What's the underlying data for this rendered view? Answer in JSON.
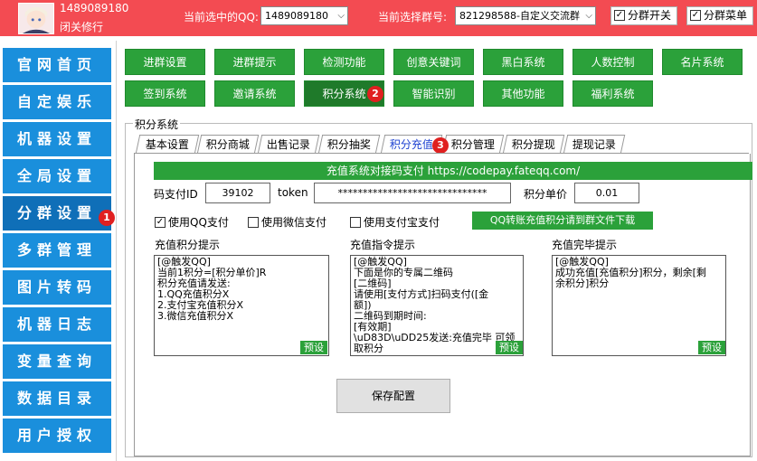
{
  "header": {
    "account_id": "1489089180",
    "account_name": "闭关修行",
    "qq_label": "当前选中的QQ:",
    "qq_value": "1489089180",
    "group_label": "当前选择群号:",
    "group_value": "821298588-自定义交流群",
    "toggle_group_switch": "分群开关",
    "toggle_group_menu": "分群菜单"
  },
  "sidebar": {
    "items": [
      {
        "label": "官网首页"
      },
      {
        "label": "自定娱乐"
      },
      {
        "label": "机器设置"
      },
      {
        "label": "全局设置"
      },
      {
        "label": "分群设置"
      },
      {
        "label": "多群管理"
      },
      {
        "label": "图片转码"
      },
      {
        "label": "机器日志"
      },
      {
        "label": "变量查询"
      },
      {
        "label": "数据目录"
      },
      {
        "label": "用户授权"
      }
    ],
    "badge": "1"
  },
  "function_buttons": [
    {
      "label": "进群设置"
    },
    {
      "label": "进群提示"
    },
    {
      "label": "检测功能"
    },
    {
      "label": "创意关键词"
    },
    {
      "label": "黑白系统"
    },
    {
      "label": "人数控制"
    },
    {
      "label": "名片系统"
    },
    {
      "label": "签到系统"
    },
    {
      "label": "邀请系统"
    },
    {
      "label": "积分系统"
    },
    {
      "label": "智能识别"
    },
    {
      "label": "其他功能"
    },
    {
      "label": "福利系统"
    }
  ],
  "function_badge": "2",
  "group_title": "积分系统",
  "tabs": [
    {
      "label": "基本设置"
    },
    {
      "label": "积分商城"
    },
    {
      "label": "出售记录"
    },
    {
      "label": "积分抽奖"
    },
    {
      "label": "积分充值"
    },
    {
      "label": "积分管理"
    },
    {
      "label": "积分提现"
    },
    {
      "label": "提现记录"
    }
  ],
  "tab_badge": "3",
  "recharge": {
    "banner": "充值系统对接码支付 https://codepay.fateqq.com/",
    "pay_id_label": "码支付ID",
    "pay_id_value": "39102",
    "token_label": "token",
    "token_value": "******************************",
    "unit_price_label": "积分单价",
    "unit_price_value": "0.01",
    "use_qq_pay": "使用QQ支付",
    "use_wechat_pay": "使用微信支付",
    "use_alipay": "使用支付宝支付",
    "download_button": "QQ转账充值积分请到群文件下载",
    "hint_title": "充值积分提示",
    "hint_lines": [
      "[@触发QQ]",
      "当前1积分=[积分单价]R",
      "积分充值请发送:",
      "1.QQ充值积分X",
      "2.支付宝充值积分X",
      "3.微信充值积分X"
    ],
    "command_title": "充值指令提示",
    "command_lines": [
      "[@触发QQ]",
      "下面是你的专属二维码",
      "[二维码]",
      "请使用[支付方式]扫码支付([金",
      "额])",
      "二维码到期时间:",
      "[有效期]",
      "\\uD83D\\uDD25发送:充值完毕 可领",
      "取积分"
    ],
    "done_title": "充值完毕提示",
    "done_lines": [
      "[@触发QQ]",
      "成功充值[充值积分]积分，剩余[剩",
      "余积分]积分"
    ],
    "preset_label": "预设",
    "save_button": "保存配置"
  }
}
